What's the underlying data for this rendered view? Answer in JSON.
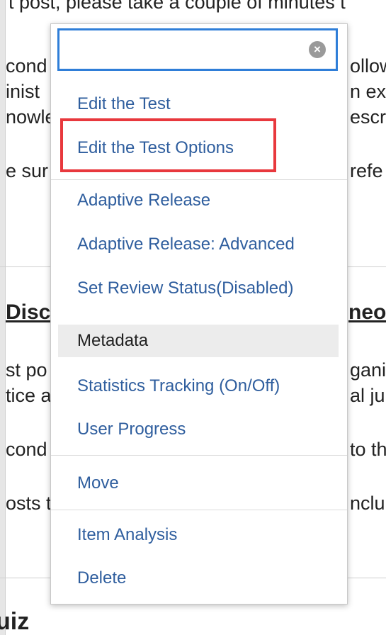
{
  "background": {
    "top_fragment": "t post, please take a couple of minutes t",
    "left_fragments": [
      "cond",
      "inist",
      "nowle",
      "e sur"
    ],
    "right_fragments": [
      "ollow",
      "n ex",
      "escri",
      "refe"
    ],
    "heading_left": "Discu",
    "heading_right": "neor",
    "left_fragments_2": [
      "st po",
      "tice a",
      "cond",
      "osts t"
    ],
    "right_fragments_2": [
      "gani",
      "al ju",
      "to th",
      "nclu"
    ],
    "bottom_title": "uiz"
  },
  "menu": {
    "search": {
      "value": "",
      "placeholder": ""
    },
    "items": [
      {
        "label": "Edit the Test"
      },
      {
        "label": "Edit the Test Options"
      },
      {
        "label": "Adaptive Release"
      },
      {
        "label": "Adaptive Release: Advanced"
      },
      {
        "label": "Set Review Status(Disabled)"
      },
      {
        "label": "Metadata"
      },
      {
        "label": "Statistics Tracking (On/Off)"
      },
      {
        "label": "User Progress"
      },
      {
        "label": "Move"
      },
      {
        "label": "Item Analysis"
      },
      {
        "label": "Delete"
      }
    ]
  },
  "colors": {
    "link": "#2f5e9e",
    "focus_border": "#2f7ed8",
    "highlight_box": "#e8383d",
    "active_row": "#ececec"
  }
}
